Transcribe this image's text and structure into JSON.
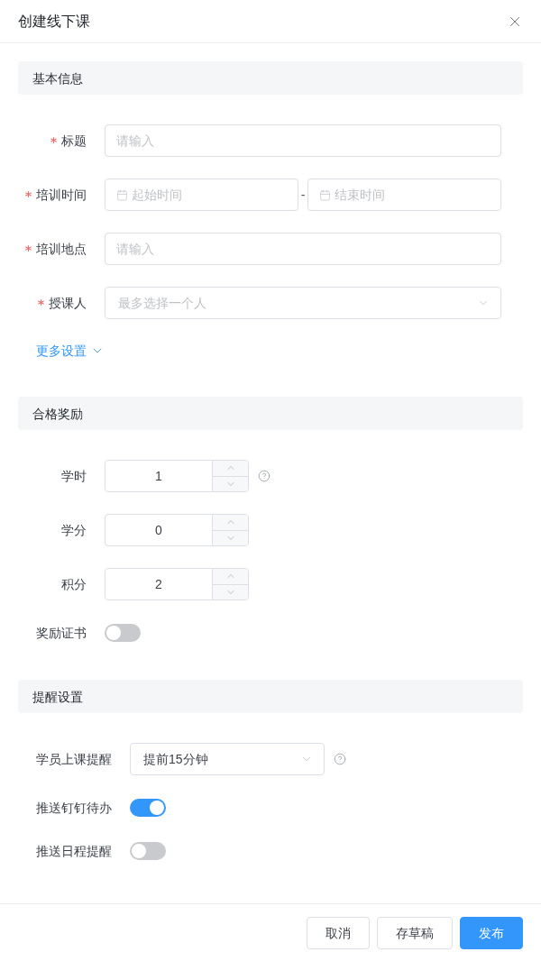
{
  "dialog": {
    "title": "创建线下课"
  },
  "sections": [
    {
      "title": "基本信息",
      "fields": [
        {
          "kind": "text",
          "label": "标题",
          "required": true,
          "placeholder": "请输入"
        },
        {
          "kind": "date_range",
          "label": "培训时间",
          "required": true,
          "start_placeholder": "起始时间",
          "separator": "-",
          "end_placeholder": "结束时间"
        },
        {
          "kind": "text",
          "label": "培训地点",
          "required": true,
          "placeholder": "请输入"
        },
        {
          "kind": "select",
          "label": "授课人",
          "required": true,
          "placeholder": "最多选择一个人",
          "help": false
        }
      ],
      "more_link": {
        "label": "更多设置",
        "expanded": false
      }
    },
    {
      "title": "合格奖励",
      "fields": [
        {
          "kind": "number",
          "label": "学时",
          "required": false,
          "value": "1",
          "help": true
        },
        {
          "kind": "number",
          "label": "学分",
          "required": false,
          "value": "0",
          "help": false
        },
        {
          "kind": "number",
          "label": "积分",
          "required": false,
          "value": "2",
          "help": false
        },
        {
          "kind": "switch",
          "label": "奖励证书",
          "required": false,
          "on": false
        }
      ]
    },
    {
      "title": "提醒设置",
      "fields": [
        {
          "kind": "select",
          "label": "学员上课提醒",
          "required": false,
          "value": "提前15分钟",
          "help": true
        },
        {
          "kind": "switch",
          "label": "推送钉钉待办",
          "required": false,
          "on": true
        },
        {
          "kind": "switch",
          "label": "推送日程提醒",
          "required": false,
          "on": false
        }
      ]
    }
  ],
  "footer": {
    "buttons": [
      {
        "label": "取消",
        "kind": "default"
      },
      {
        "label": "存草稿",
        "kind": "default"
      },
      {
        "label": "发布",
        "kind": "primary"
      }
    ]
  }
}
